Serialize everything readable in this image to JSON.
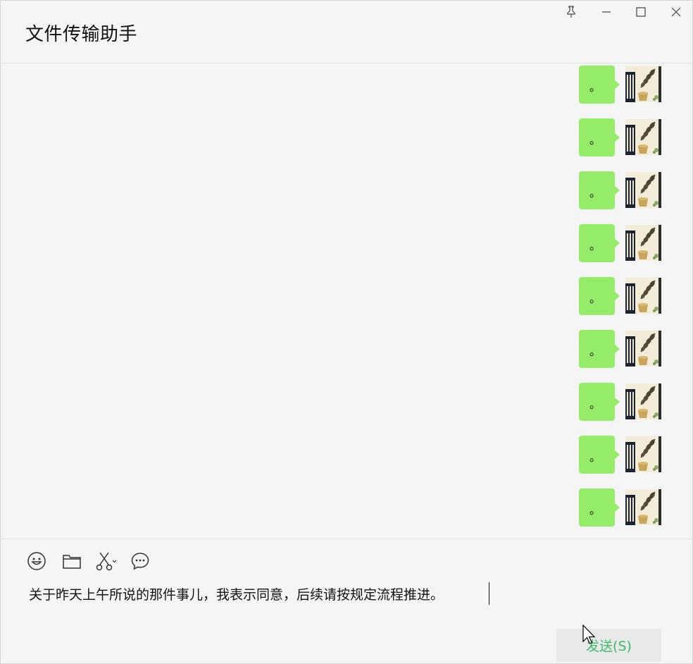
{
  "window": {
    "title": "文件传输助手",
    "controls": {
      "pin": "pin-icon",
      "minimize": "minimize-icon",
      "maximize": "maximize-icon",
      "close": "close-icon"
    }
  },
  "messages": [
    {
      "text": "。",
      "sender": "self"
    },
    {
      "text": "。",
      "sender": "self"
    },
    {
      "text": "。",
      "sender": "self"
    },
    {
      "text": "。",
      "sender": "self"
    },
    {
      "text": "。",
      "sender": "self"
    },
    {
      "text": "。",
      "sender": "self"
    },
    {
      "text": "。",
      "sender": "self"
    },
    {
      "text": "。",
      "sender": "self"
    },
    {
      "text": "。",
      "sender": "self"
    }
  ],
  "toolbar": {
    "icons": [
      "emoji-icon",
      "folder-icon",
      "scissors-icon",
      "chat-bubble-icon"
    ]
  },
  "composer": {
    "value": "关于昨天上午所说的那件事儿，我表示同意，后续请按规定流程推进。"
  },
  "send_button": {
    "label": "发送(S)"
  },
  "colors": {
    "bubble": "#95ec69",
    "send_text": "#3dbd6a",
    "background": "#f5f5f5"
  }
}
